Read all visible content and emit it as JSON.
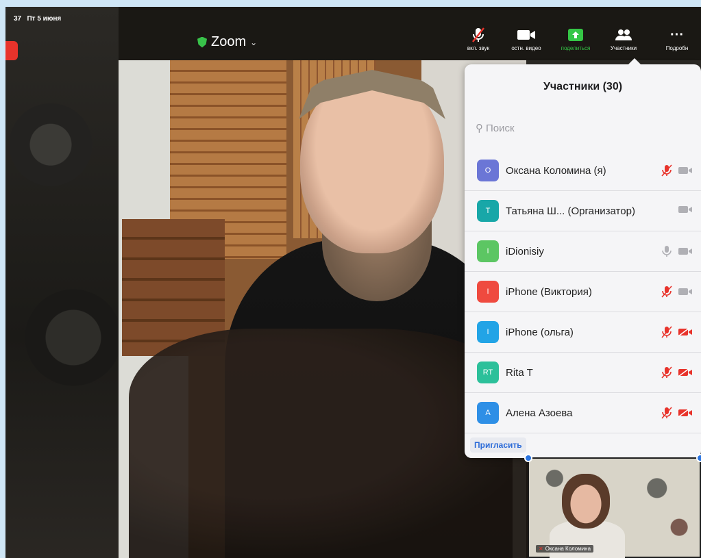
{
  "status_bar": {
    "time": "37",
    "date": "Пт 5 июня"
  },
  "meeting": {
    "title": "Zoom"
  },
  "toolbar": {
    "unmute_label": "вкл. звук",
    "stop_video_label": "остн. видео",
    "share_label": "поделиться",
    "participants_label": "Участники",
    "more_label": "Подробн"
  },
  "participants_panel": {
    "title": "Участники (30)",
    "search_placeholder": "Поиск",
    "invite_label": "Пригласить",
    "participants": [
      {
        "initials": "О",
        "name": "Оксана Коломина (я)",
        "avatar_color": "#6b76d6",
        "mic": "muted",
        "video": "on"
      },
      {
        "initials": "Т",
        "name": "Татьяна Ш...  (Организатор)",
        "avatar_color": "#18a7a8",
        "mic": "none",
        "video": "on"
      },
      {
        "initials": "I",
        "name": "iDionisiy",
        "avatar_color": "#5cc663",
        "mic": "on",
        "video": "on"
      },
      {
        "initials": "I",
        "name": "iPhone (Виктория)",
        "avatar_color": "#ef4a3f",
        "mic": "muted",
        "video": "on"
      },
      {
        "initials": "I",
        "name": "iPhone (ольга)",
        "avatar_color": "#22a4e6",
        "mic": "muted",
        "video": "off"
      },
      {
        "initials": "RT",
        "name": "Rita T",
        "avatar_color": "#2cc09a",
        "mic": "muted",
        "video": "off"
      },
      {
        "initials": "A",
        "name": "Алена Азоева",
        "avatar_color": "#2e8fe6",
        "mic": "muted",
        "video": "off"
      }
    ]
  },
  "self_view": {
    "name": "Оксана Коломина"
  },
  "colors": {
    "accent_green": "#35c646",
    "muted_red": "#e8332b",
    "link_blue": "#2a6ad8"
  }
}
